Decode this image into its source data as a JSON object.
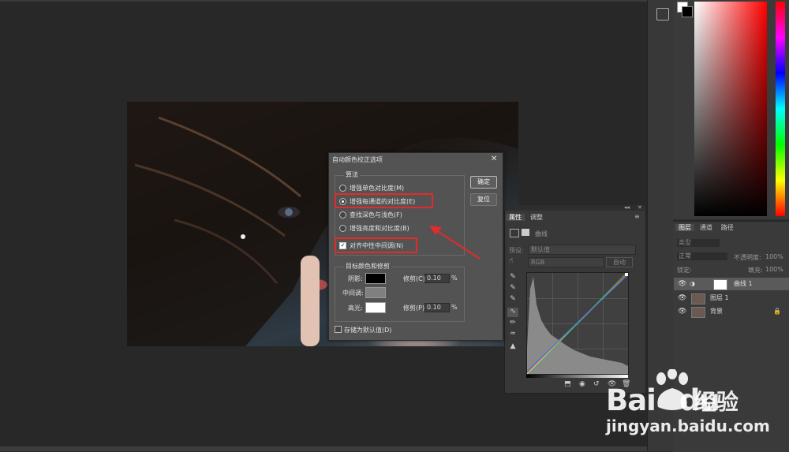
{
  "dialog": {
    "title": "自动颜色校正选项",
    "close_glyph": "✕",
    "algorithm_label": "算法",
    "options": [
      {
        "label": "增强单色对比度(M)",
        "selected": false
      },
      {
        "label": "增强每通道的对比度(E)",
        "selected": true
      },
      {
        "label": "查找深色与浅色(F)",
        "selected": false
      },
      {
        "label": "增强亮度和对比度(B)",
        "selected": false
      }
    ],
    "snap_neutral_label": "对齐中性中间调(N)",
    "snap_neutral_checked": true,
    "ok_label": "确定",
    "reset_label": "复位",
    "target_label": "目标颜色和修剪",
    "shadows_label": "阴影:",
    "midtones_label": "中间调:",
    "highlights_label": "高光:",
    "clip_label_shadows": "修剪(C):",
    "clip_label_highlights": "修剪(P):",
    "clip_shadows_value": "0.10",
    "clip_highlights_value": "0.10",
    "percent": "%",
    "save_default_label": "存储为默认值(D)",
    "colors": {
      "shadows": "#000000",
      "midtones": "#808080",
      "highlights": "#ffffff"
    }
  },
  "properties": {
    "tab_properties": "属性",
    "tab_adjustments": "调整",
    "panel_title": "曲线",
    "preset_label": "预设:",
    "preset_value": "默认值",
    "channel_value": "RGB",
    "auto_label": "自动"
  },
  "layers": {
    "tabs": [
      "图层",
      "通道",
      "路径"
    ],
    "kind_label": "类型",
    "blend_mode": "正常",
    "opacity_label": "不透明度:",
    "opacity_value": "100%",
    "lock_label": "锁定:",
    "fill_label": "填充:",
    "fill_value": "100%",
    "items": [
      {
        "name": "曲线 1",
        "type": "adjustment"
      },
      {
        "name": "图层 1",
        "type": "pixel"
      },
      {
        "name": "背景",
        "type": "background"
      }
    ]
  },
  "watermark": {
    "brand": "Bai",
    "brand_tail": "du",
    "chinese": "经验",
    "url": "jingyan.baidu.com"
  },
  "accent": {
    "highlight_box": "#e32b2b",
    "arrow": "#e32b2b"
  }
}
